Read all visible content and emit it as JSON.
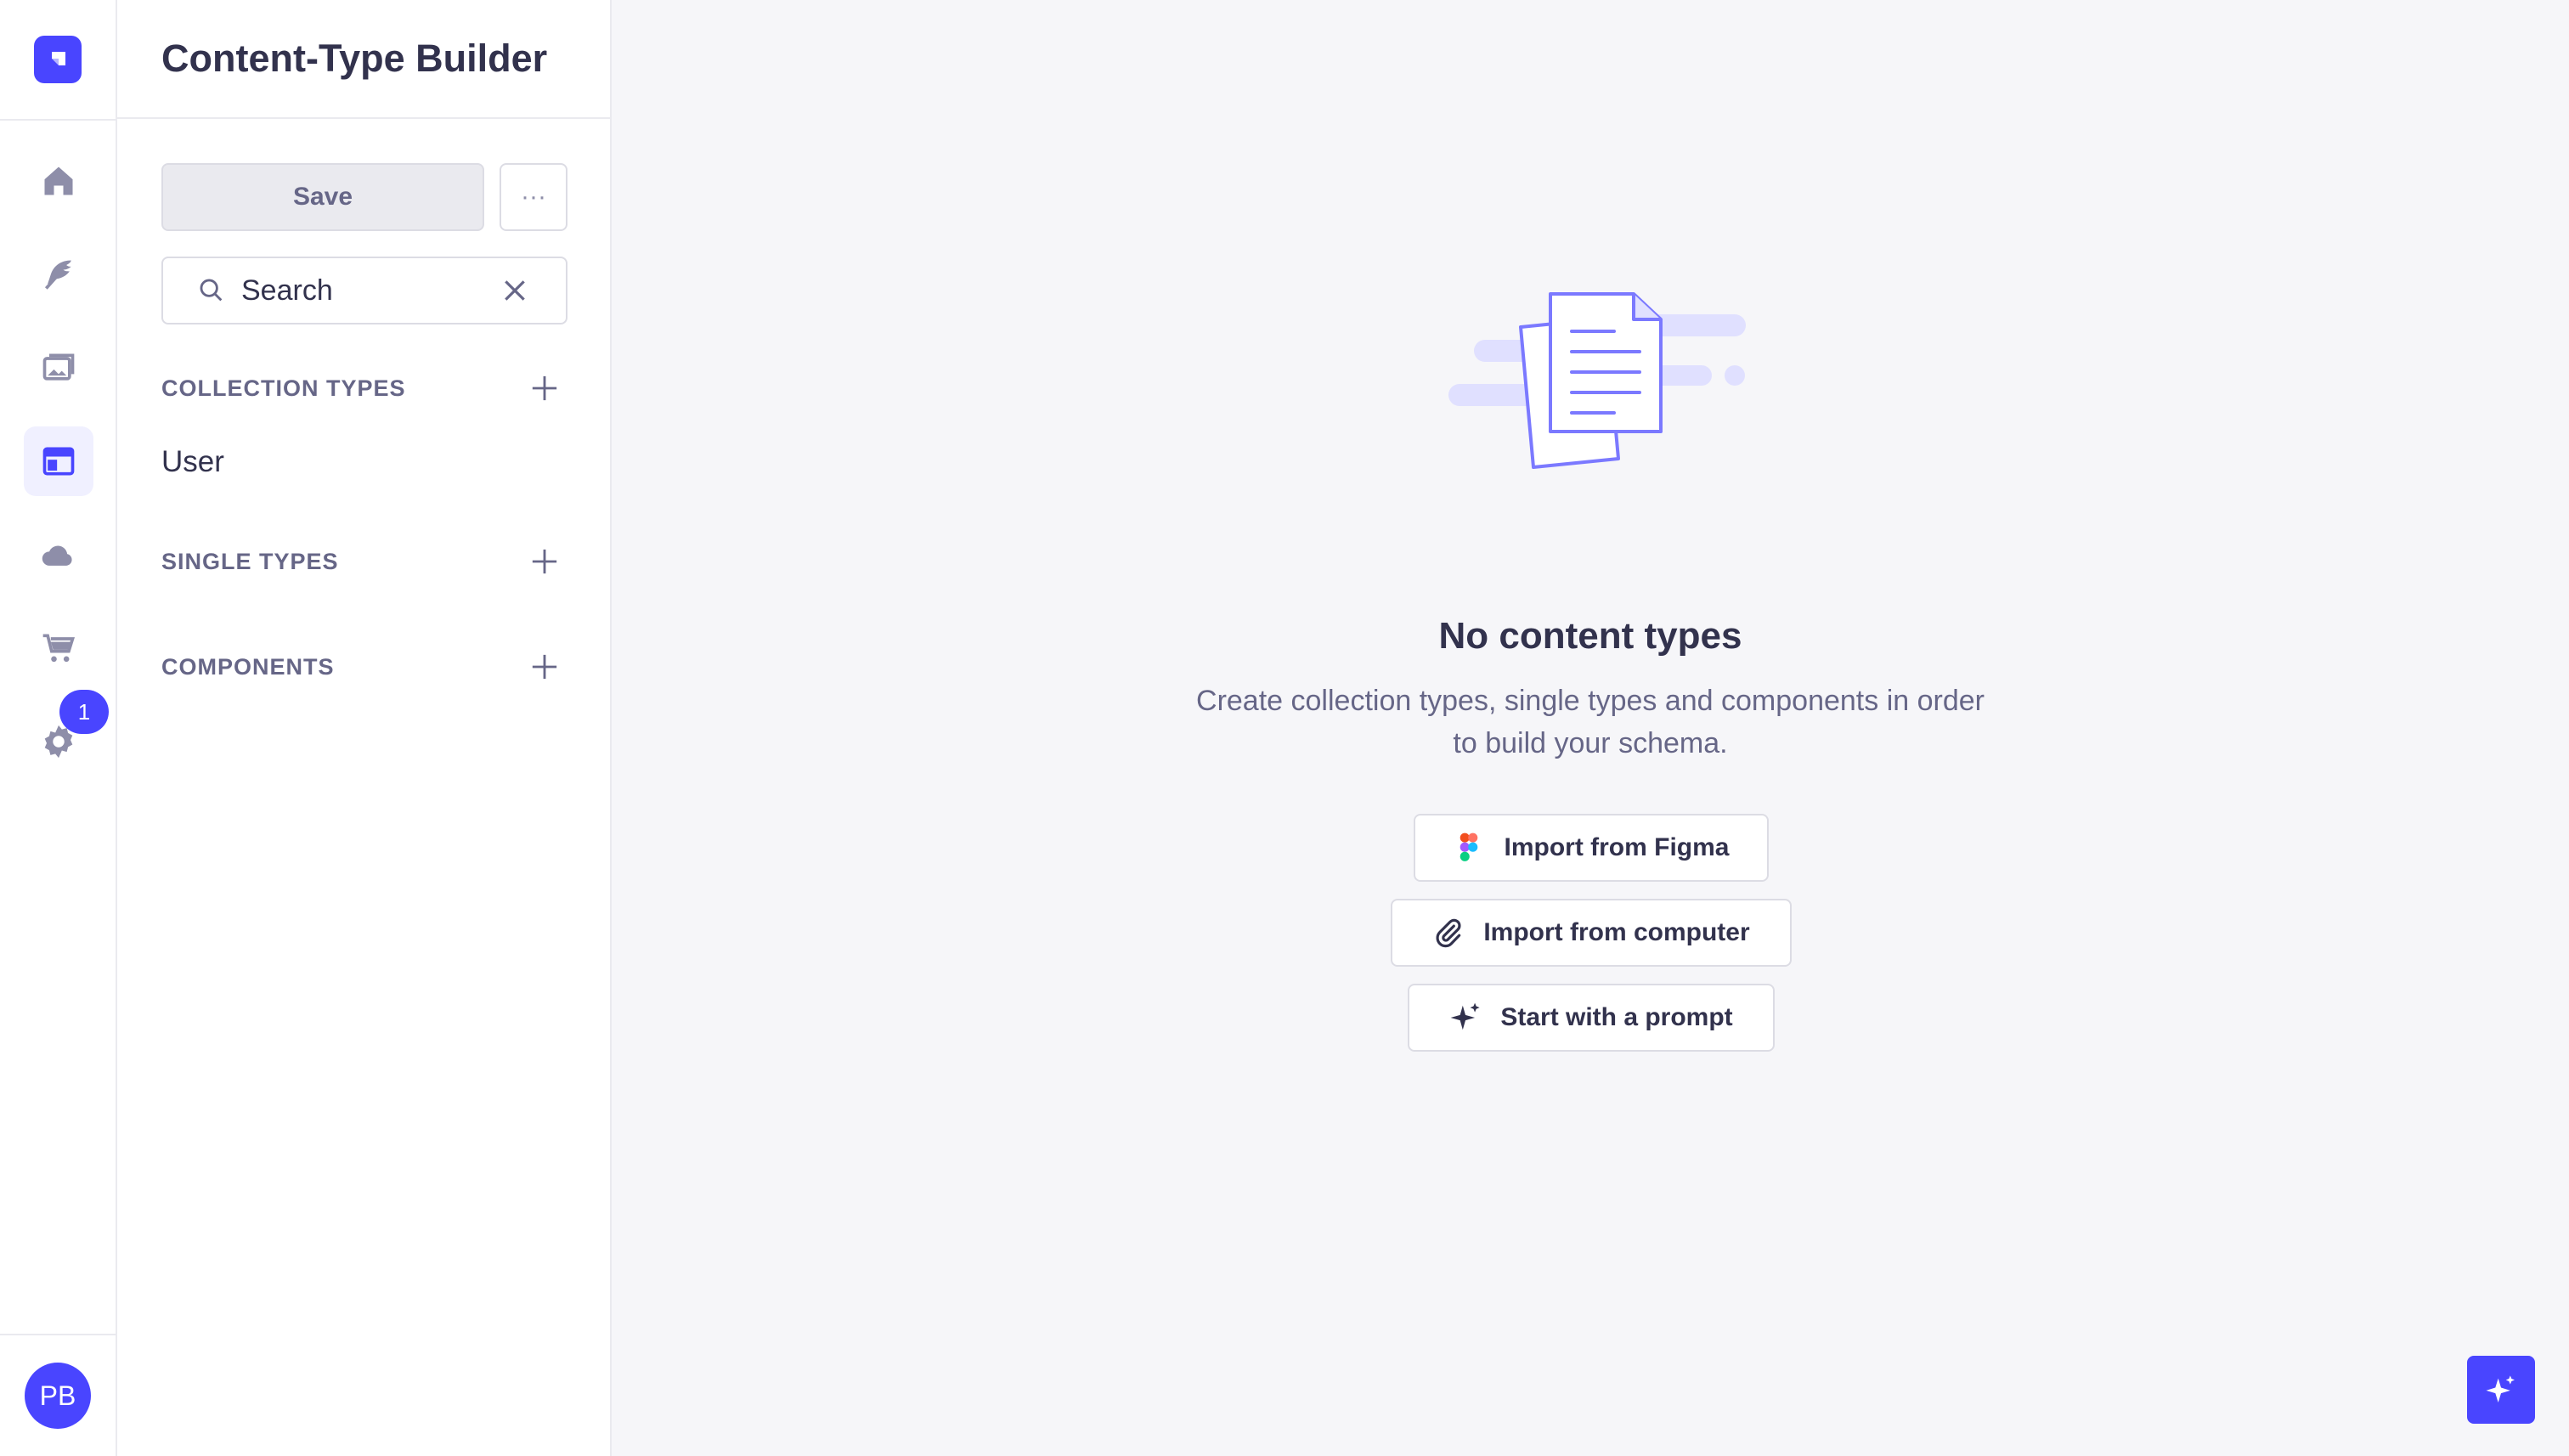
{
  "app": {
    "brand_color": "#4945ff",
    "nav": [
      {
        "name": "home",
        "icon": "home-icon"
      },
      {
        "name": "content-manager",
        "icon": "feather-icon"
      },
      {
        "name": "media-library",
        "icon": "images-icon"
      },
      {
        "name": "content-type-builder",
        "icon": "layout-icon",
        "active": true
      },
      {
        "name": "cloud",
        "icon": "cloud-icon"
      },
      {
        "name": "marketplace",
        "icon": "cart-icon"
      },
      {
        "name": "settings",
        "icon": "gear-icon"
      }
    ],
    "settings_badge": "1",
    "user_initials": "PB"
  },
  "sidebar": {
    "title": "Content-Type Builder",
    "save_label": "Save",
    "more_label": "···",
    "search_value": "Search",
    "sections": [
      {
        "label": "COLLECTION TYPES",
        "items": [
          "User"
        ]
      },
      {
        "label": "SINGLE TYPES",
        "items": []
      },
      {
        "label": "COMPONENTS",
        "items": []
      }
    ]
  },
  "main": {
    "empty_title": "No content types",
    "empty_desc_line1": "Create collection types, single types and components in order",
    "empty_desc_line2": "to build your schema.",
    "actions": [
      {
        "label": "Import from Figma",
        "icon": "figma-icon"
      },
      {
        "label": "Import from computer",
        "icon": "paperclip-icon"
      },
      {
        "label": "Start with a prompt",
        "icon": "sparkle-icon"
      }
    ]
  }
}
